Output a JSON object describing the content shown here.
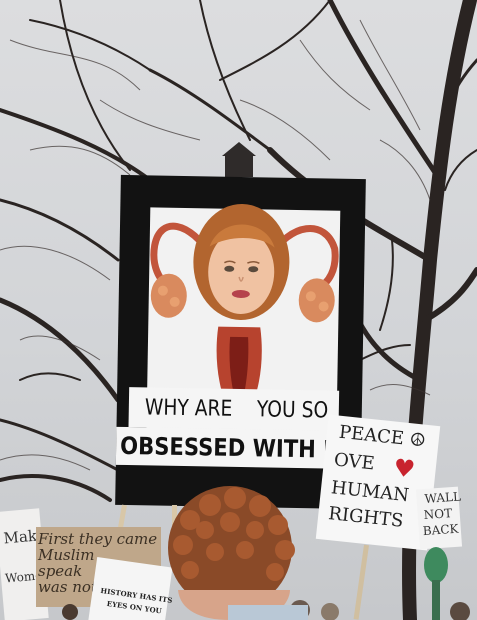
{
  "main_sign": {
    "line1_left": "WHY ARE",
    "line1_right": "YOU SO",
    "line2": "OBSESSED WITH ME?"
  },
  "peace_sign": {
    "line1": "PEACE ☮",
    "line2": "OVE",
    "line3": "HUMAN",
    "line4": "RIGHTS"
  },
  "wall_sign": {
    "line1": "WALL",
    "line2": "NOT",
    "line3": "BACK"
  },
  "left_sign": {
    "line1": "Make",
    "line2": "Women"
  },
  "brown_sign": {
    "line1": "First they came",
    "line2": "Muslim",
    "line3": "speak",
    "line4": "was not"
  },
  "history_sign": {
    "line1": "HISTORY HAS ITS",
    "line2": "EYES ON YOU"
  },
  "colors": {
    "sky": "#dcdddf",
    "sign_black": "#121212",
    "heart_red": "#c8232e",
    "hair": "#a0522d"
  }
}
